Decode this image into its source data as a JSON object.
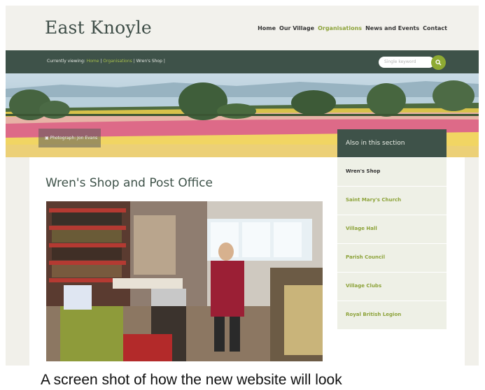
{
  "site": {
    "title": "East Knoyle"
  },
  "nav": {
    "items": [
      "Home",
      "Our Village",
      "Organisations",
      "News and Events",
      "Contact"
    ],
    "active": "Organisations"
  },
  "breadcrumb": {
    "prefix": "Currently viewing:",
    "items": [
      "Home",
      "Organisations",
      "Wren's Shop"
    ],
    "separator": "|"
  },
  "search": {
    "placeholder": "Single keyword",
    "button_icon": "search-icon"
  },
  "banner": {
    "credit": "Photograph: Jon Evans",
    "credit_icon": "camera-icon"
  },
  "page": {
    "title": "Wren's Shop and Post Office"
  },
  "sidebar": {
    "heading": "Also in this section",
    "items": [
      "Wren's Shop",
      "Saint Mary's Church",
      "Village Hall",
      "Parish Council",
      "Village Clubs",
      "Royal British Legion"
    ],
    "current": "Wren's Shop"
  },
  "caption": "A screen shot of how the new website will look",
  "colors": {
    "accent": "#8da33a",
    "dark_green": "#3e5249",
    "background": "#f1f0ea"
  }
}
